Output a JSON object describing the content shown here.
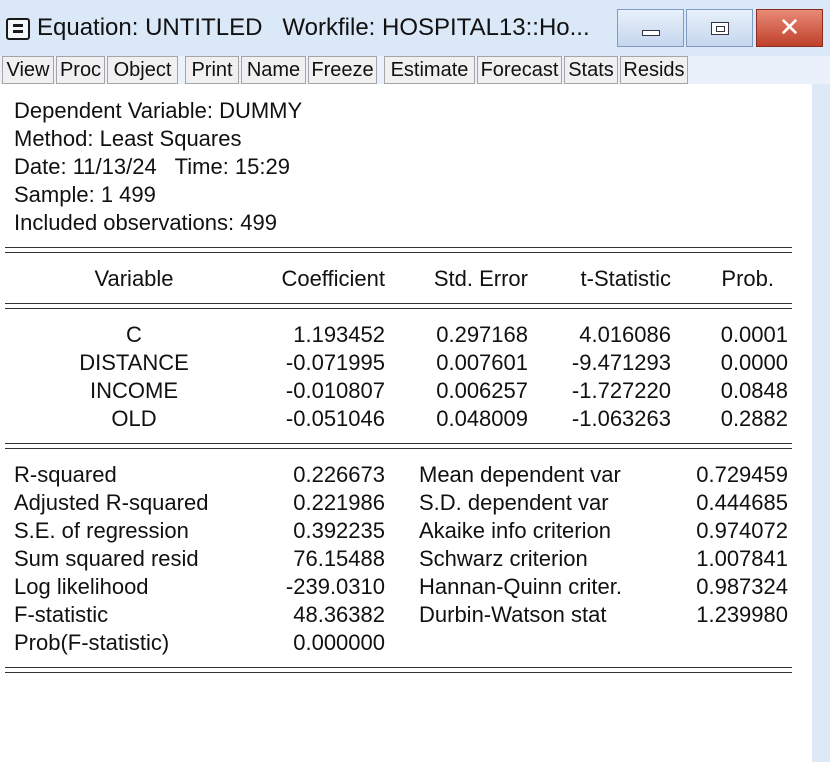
{
  "window": {
    "title": "Equation: UNTITLED   Workfile: HOSPITAL13::Ho..."
  },
  "toolbar": {
    "buttons": [
      "View",
      "Proc",
      "Object",
      "Print",
      "Name",
      "Freeze",
      "Estimate",
      "Forecast",
      "Stats",
      "Resids"
    ]
  },
  "header": {
    "dependent": "Dependent Variable: DUMMY",
    "method": "Method: Least Squares",
    "datetime": "Date: 11/13/24   Time: 15:29",
    "sample": "Sample: 1 499",
    "observations": "Included observations: 499"
  },
  "table": {
    "columns": [
      "Variable",
      "Coefficient",
      "Std. Error",
      "t-Statistic",
      "Prob."
    ],
    "rows": [
      [
        "C",
        "1.193452",
        "0.297168",
        "4.016086",
        "0.0001"
      ],
      [
        "DISTANCE",
        "-0.071995",
        "0.007601",
        "-9.471293",
        "0.0000"
      ],
      [
        "INCOME",
        "-0.010807",
        "0.006257",
        "-1.727220",
        "0.0848"
      ],
      [
        "OLD",
        "-0.051046",
        "0.048009",
        "-1.063263",
        "0.2882"
      ]
    ]
  },
  "stats": {
    "left": [
      [
        "R-squared",
        "0.226673"
      ],
      [
        "Adjusted R-squared",
        "0.221986"
      ],
      [
        "S.E. of regression",
        "0.392235"
      ],
      [
        "Sum squared resid",
        "76.15488"
      ],
      [
        "Log likelihood",
        "-239.0310"
      ],
      [
        "F-statistic",
        "48.36382"
      ],
      [
        "Prob(F-statistic)",
        "0.000000"
      ]
    ],
    "right": [
      [
        "Mean dependent var",
        "0.729459"
      ],
      [
        "S.D. dependent var",
        "0.444685"
      ],
      [
        "Akaike info criterion",
        "0.974072"
      ],
      [
        "Schwarz criterion",
        "1.007841"
      ],
      [
        "Hannan-Quinn criter.",
        "0.987324"
      ],
      [
        "Durbin-Watson stat",
        "1.239980"
      ]
    ]
  }
}
